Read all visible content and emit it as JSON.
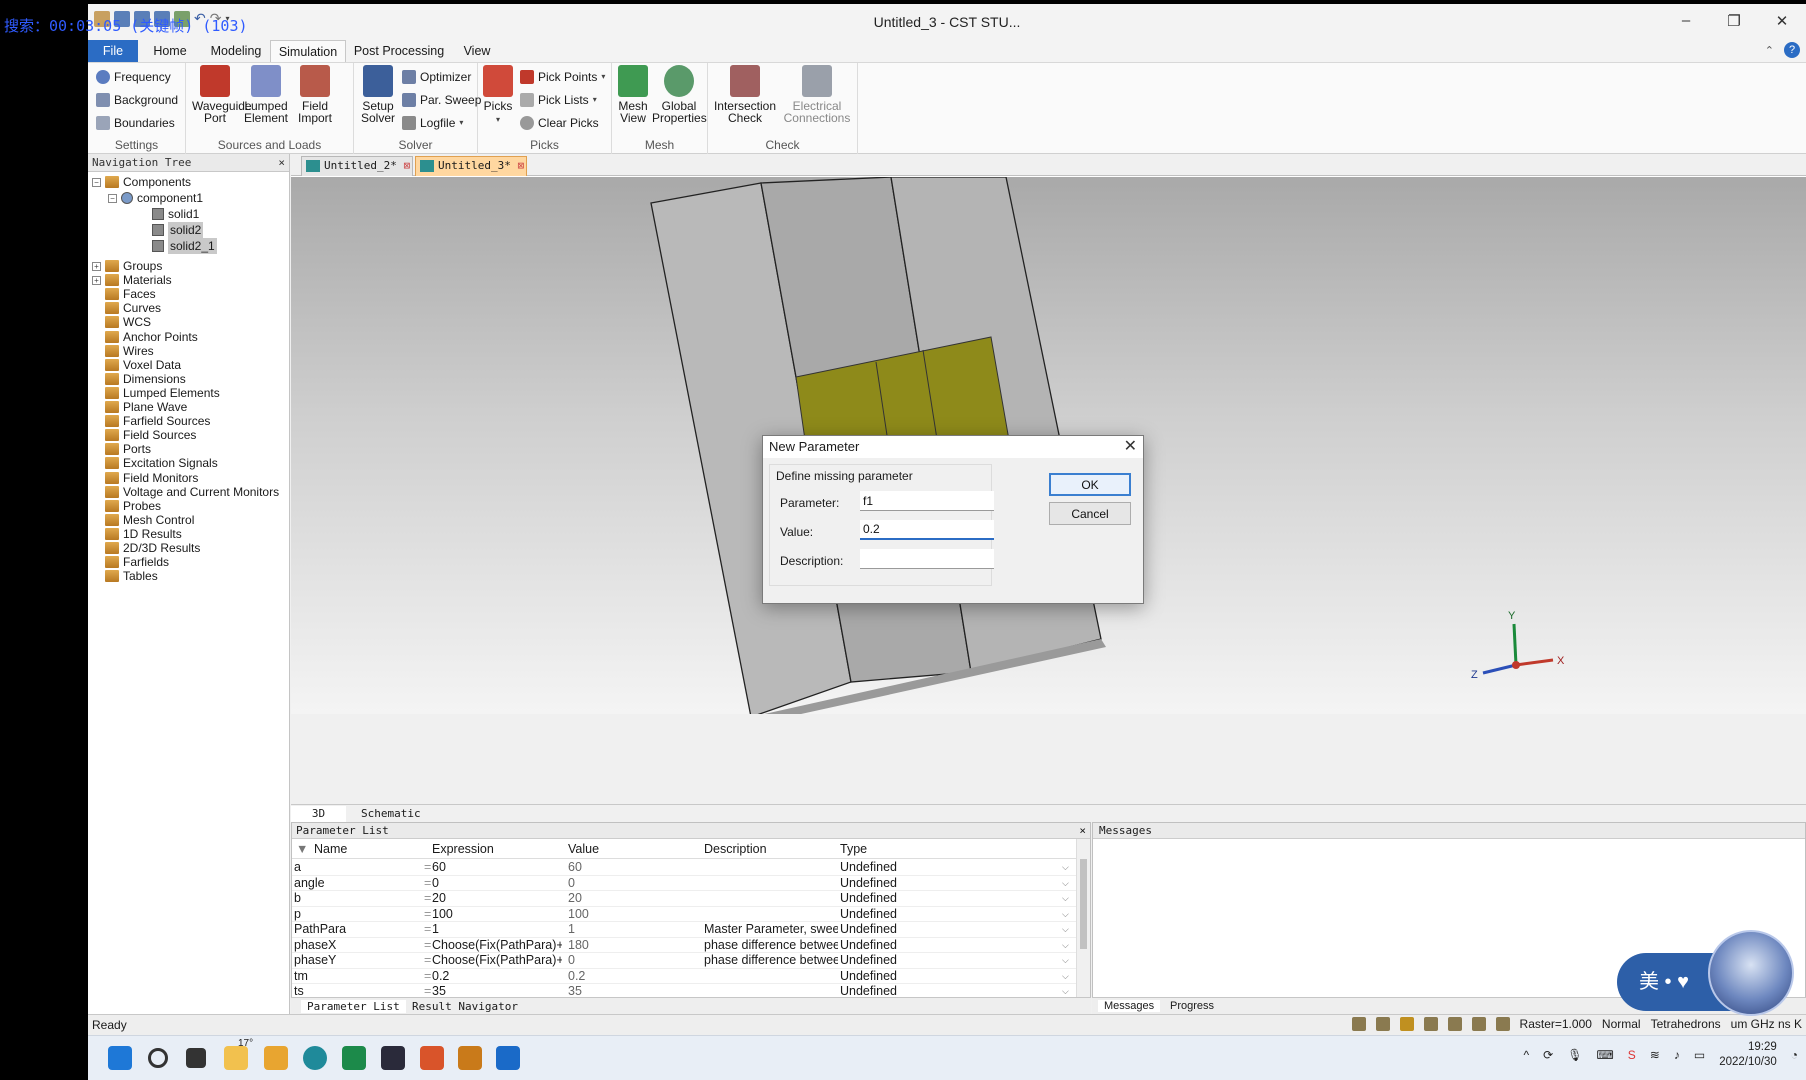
{
  "overlay_text": "搜索：00:03:05 (关键帧) (103)",
  "window": {
    "title": "Untitled_3 - CST STU...",
    "min": "–",
    "restore": "❐",
    "close": "✕"
  },
  "menu": {
    "file": "File",
    "tabs": [
      "Home",
      "Modeling",
      "Simulation",
      "Post Processing",
      "View"
    ],
    "active": "Simulation"
  },
  "ribbon": {
    "settings": {
      "label": "Settings",
      "items": [
        "Frequency",
        "Background",
        "Boundaries"
      ]
    },
    "sources": {
      "label": "Sources and Loads",
      "items": [
        [
          "Waveguide",
          "Port"
        ],
        [
          "Lumped",
          "Element"
        ],
        [
          "Field",
          "Import"
        ]
      ]
    },
    "solver": {
      "label": "Solver",
      "setup": [
        "Setup",
        "Solver"
      ],
      "items": [
        "Optimizer",
        "Par. Sweep",
        "Logfile"
      ]
    },
    "picks": {
      "label": "Picks",
      "big": "Picks",
      "items": [
        "Pick Points",
        "Pick Lists",
        "Clear Picks"
      ]
    },
    "mesh": {
      "label": "Mesh",
      "items": [
        [
          "Mesh",
          "View"
        ],
        [
          "Global",
          "Properties"
        ]
      ]
    },
    "check": {
      "label": "Check",
      "items": [
        [
          "Intersection",
          "Check"
        ],
        [
          "Electrical",
          "Connections"
        ]
      ]
    }
  },
  "navtree": {
    "title": "Navigation Tree",
    "close": "×",
    "components": "Components",
    "component1": "component1",
    "solids": [
      "solid1",
      "solid2",
      "solid2_1"
    ],
    "items": [
      "Groups",
      "Materials",
      "Faces",
      "Curves",
      "WCS",
      "Anchor Points",
      "Wires",
      "Voxel Data",
      "Dimensions",
      "Lumped Elements",
      "Plane Wave",
      "Farfield Sources",
      "Field Sources",
      "Ports",
      "Excitation Signals",
      "Field Monitors",
      "Voltage and Current Monitors",
      "Probes",
      "Mesh Control",
      "1D Results",
      "2D/3D Results",
      "Farfields",
      "Tables"
    ]
  },
  "doctabs": [
    "Untitled_2*",
    "Untitled_3*"
  ],
  "viewtabs": [
    "3D",
    "Schematic"
  ],
  "axes": {
    "x": "X",
    "y": "Y",
    "z": "Z"
  },
  "paramlist": {
    "title": "Parameter List",
    "close": "×",
    "columns": [
      "Name",
      "Expression",
      "Value",
      "Description",
      "Type"
    ],
    "rows": [
      {
        "name": "a",
        "expr": "60",
        "value": "60",
        "desc": "",
        "type": "Undefined"
      },
      {
        "name": "angle",
        "expr": "0",
        "value": "0",
        "desc": "",
        "type": "Undefined"
      },
      {
        "name": "b",
        "expr": "20",
        "value": "20",
        "desc": "",
        "type": "Undefined"
      },
      {
        "name": "p",
        "expr": "100",
        "value": "100",
        "desc": "",
        "type": "Undefined"
      },
      {
        "name": "PathPara",
        "expr": "1",
        "value": "1",
        "desc": "Master Parameter, swee...",
        "type": "Undefined"
      },
      {
        "name": "phaseX",
        "expr": "Choose(Fix(PathPara)+1,...",
        "value": "180",
        "desc": "phase difference betwee...",
        "type": "Undefined"
      },
      {
        "name": "phaseY",
        "expr": "Choose(Fix(PathPara)+1,...",
        "value": "0",
        "desc": "phase difference betwee...",
        "type": "Undefined"
      },
      {
        "name": "tm",
        "expr": "0.2",
        "value": "0.2",
        "desc": "",
        "type": "Undefined"
      },
      {
        "name": "ts",
        "expr": "35",
        "value": "35",
        "desc": "",
        "type": "Undefined"
      }
    ],
    "bottom_tabs": [
      "Parameter List",
      "Result Navigator"
    ]
  },
  "messages": {
    "title": "Messages",
    "tabs": [
      "Messages",
      "Progress"
    ]
  },
  "status": {
    "ready": "Ready",
    "raster": "Raster=1.000",
    "mode": "Normal",
    "mesh": "Tetrahedrons",
    "units": "um GHz ns K"
  },
  "dialog": {
    "title": "New Parameter",
    "group": "Define missing parameter",
    "param_label": "Parameter:",
    "param_value": "f1",
    "value_label": "Value:",
    "value_value": "0.2",
    "desc_label": "Description:",
    "desc_value": "",
    "ok": "OK",
    "cancel": "Cancel"
  },
  "taskbar": {
    "weather": "17°",
    "time": "19:29",
    "date": "2022/10/30"
  },
  "chat": {
    "text": "美 • ♥"
  }
}
